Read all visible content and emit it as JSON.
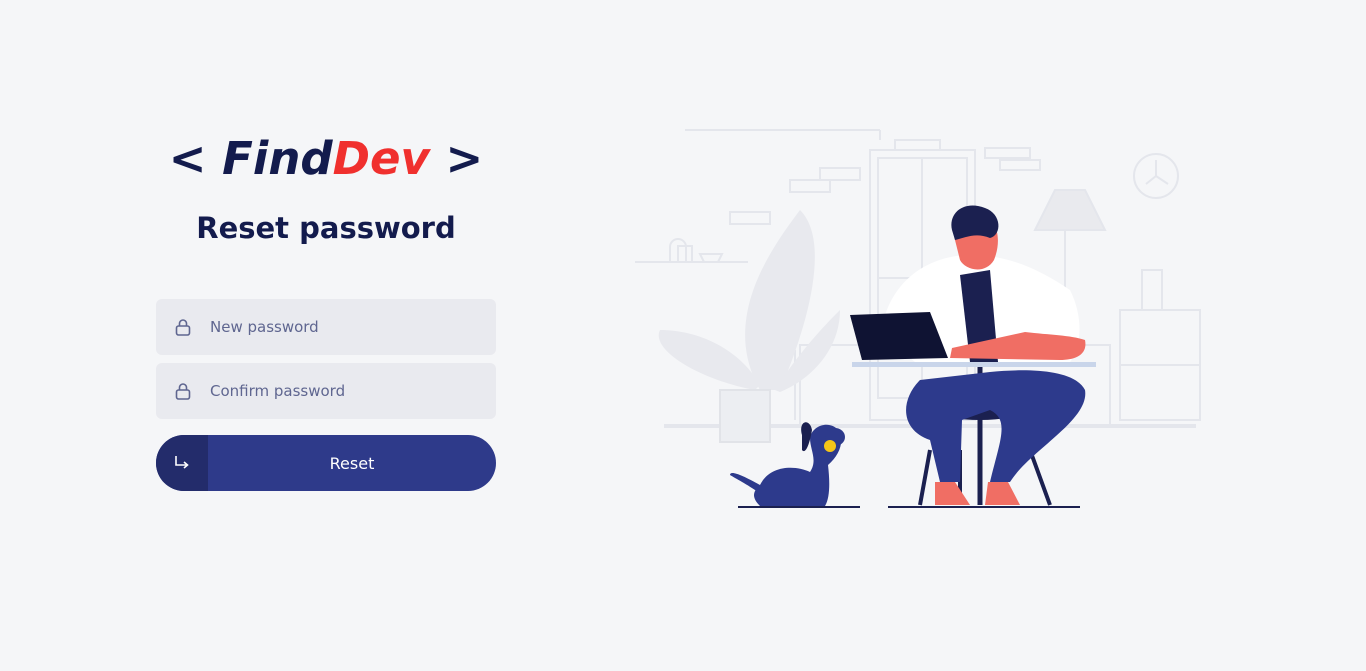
{
  "brand": {
    "open": "<",
    "name_part1": "Find",
    "name_part2": "Dev",
    "close": ">",
    "color_primary": "#131b4d",
    "color_accent": "#f0302e"
  },
  "heading": "Reset password",
  "form": {
    "new_password": {
      "placeholder": "New password",
      "value": "",
      "icon": "lock-icon"
    },
    "confirm_password": {
      "placeholder": "Confirm password",
      "value": "",
      "icon": "lock-icon"
    },
    "submit": {
      "label": "Reset",
      "icon": "arrow-enter-icon",
      "color": "#2e3a8a"
    }
  },
  "illustration": {
    "subject": "person-working-laptop-with-dog"
  }
}
